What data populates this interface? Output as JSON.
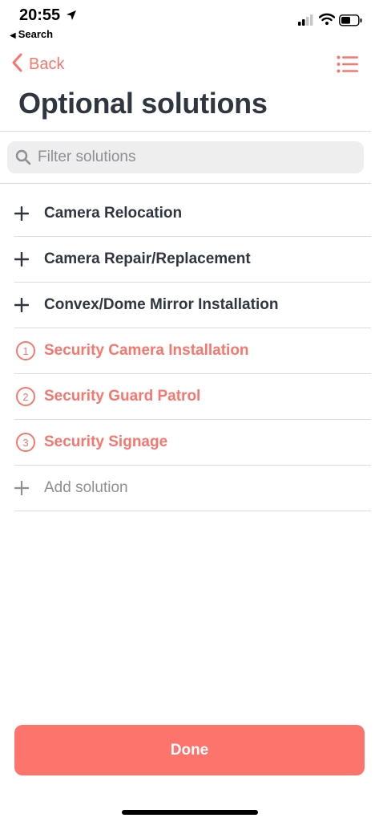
{
  "status_bar": {
    "time": "20:55",
    "back_app_label": "Search"
  },
  "nav": {
    "back_label": "Back",
    "accent_color": "#f7776e"
  },
  "page": {
    "title": "Optional solutions"
  },
  "search": {
    "placeholder": "Filter solutions",
    "value": ""
  },
  "solutions": [
    {
      "label": "Camera Relocation",
      "selected": false
    },
    {
      "label": "Camera Repair/Replacement",
      "selected": false
    },
    {
      "label": "Convex/Dome Mirror Installation",
      "selected": false
    },
    {
      "label": "Security Camera Installation",
      "selected": true,
      "order": "1"
    },
    {
      "label": "Security Guard Patrol",
      "selected": true,
      "order": "2"
    },
    {
      "label": "Security Signage",
      "selected": true,
      "order": "3"
    }
  ],
  "add_solution": {
    "label": "Add solution"
  },
  "footer": {
    "done_label": "Done",
    "button_color": "#fc746c"
  }
}
